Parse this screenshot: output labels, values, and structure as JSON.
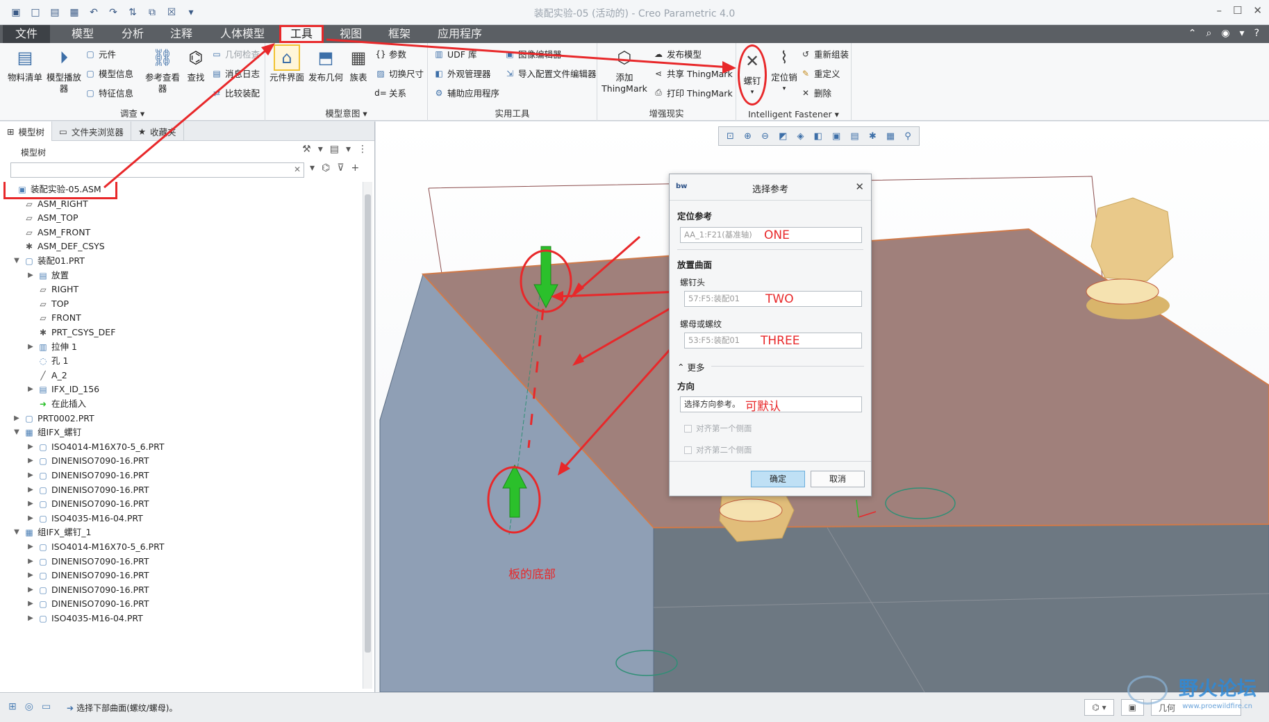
{
  "window": {
    "title": "装配实验-05 (活动的) - Creo Parametric 4.0"
  },
  "tabs": [
    {
      "label": "文件"
    },
    {
      "label": "模型"
    },
    {
      "label": "分析"
    },
    {
      "label": "注释"
    },
    {
      "label": "人体模型"
    },
    {
      "label": "工具"
    },
    {
      "label": "视图"
    },
    {
      "label": "框架"
    },
    {
      "label": "应用程序"
    }
  ],
  "ribbon": {
    "investigate": {
      "label": "调查",
      "bom": "物料清单",
      "model_player": "模型播放器",
      "component": "元件",
      "model_info": "模型信息",
      "feature_info": "特征信息",
      "ref_viewer": "参考查看器",
      "find": "查找",
      "geom_check": "几何检查",
      "message_log": "消息日志",
      "compare_parts": "比较装配"
    },
    "model_intent": {
      "label": "模型意图",
      "component_interface": "元件界面",
      "publish_geometry": "发布几何",
      "family_table": "族表",
      "parameters": "参数",
      "switch_dims": "切换尺寸",
      "relations": "关系"
    },
    "utilities": {
      "label": "实用工具",
      "udf_library": "UDF 库",
      "appearance_manager": "外观管理器",
      "aux_apps": "辅助应用程序",
      "image_editor": "图像编辑器",
      "import_config_editor": "导入配置文件编辑器"
    },
    "augmented_reality": {
      "label": "增强现实",
      "add_thingmark": "添加 ThingMark",
      "publish_model": "发布模型",
      "share_thingmark": "共享 ThingMark",
      "print_thingmark": "打印 ThingMark"
    },
    "fastener": {
      "label": "Intelligent Fastener",
      "screw": "螺钉",
      "dowel_pin": "定位销",
      "reassemble": "重新组装",
      "redefine": "重定义",
      "delete": "删除"
    }
  },
  "left_panel": {
    "tabs": [
      "模型树",
      "文件夹浏览器",
      "收藏夹"
    ],
    "header": "模型树",
    "search_value": "",
    "tree": [
      {
        "label": "装配实验-05.ASM",
        "level": 0,
        "expander": "",
        "icon": "asm"
      },
      {
        "label": "ASM_RIGHT",
        "level": 1,
        "expander": "",
        "icon": "plane"
      },
      {
        "label": "ASM_TOP",
        "level": 1,
        "expander": "",
        "icon": "plane"
      },
      {
        "label": "ASM_FRONT",
        "level": 1,
        "expander": "",
        "icon": "plane"
      },
      {
        "label": "ASM_DEF_CSYS",
        "level": 1,
        "expander": "",
        "icon": "csys"
      },
      {
        "label": "装配01.PRT",
        "level": 1,
        "expander": "▼",
        "icon": "part"
      },
      {
        "label": "放置",
        "level": 2,
        "expander": "▶",
        "icon": "folder"
      },
      {
        "label": "RIGHT",
        "level": 2,
        "expander": "",
        "icon": "plane"
      },
      {
        "label": "TOP",
        "level": 2,
        "expander": "",
        "icon": "plane"
      },
      {
        "label": "FRONT",
        "level": 2,
        "expander": "",
        "icon": "plane"
      },
      {
        "label": "PRT_CSYS_DEF",
        "level": 2,
        "expander": "",
        "icon": "csys"
      },
      {
        "label": "拉伸 1",
        "level": 2,
        "expander": "▶",
        "icon": "extrude"
      },
      {
        "label": "孔 1",
        "level": 2,
        "expander": "",
        "icon": "hole"
      },
      {
        "label": "A_2",
        "level": 2,
        "expander": "",
        "icon": "axis"
      },
      {
        "label": "IFX_ID_156",
        "level": 2,
        "expander": "▶",
        "icon": "folder"
      },
      {
        "label": "在此插入",
        "level": 2,
        "expander": "",
        "icon": "insert"
      },
      {
        "label": "PRT0002.PRT",
        "level": 1,
        "expander": "▶",
        "icon": "part"
      },
      {
        "label": "组IFX_螺钉",
        "level": 1,
        "expander": "▼",
        "icon": "group"
      },
      {
        "label": "ISO4014-M16X70-5_6.PRT",
        "level": 2,
        "expander": "▶",
        "icon": "part"
      },
      {
        "label": "DINENISO7090-16.PRT",
        "level": 2,
        "expander": "▶",
        "icon": "part"
      },
      {
        "label": "DINENISO7090-16.PRT",
        "level": 2,
        "expander": "▶",
        "icon": "part"
      },
      {
        "label": "DINENISO7090-16.PRT",
        "level": 2,
        "expander": "▶",
        "icon": "part"
      },
      {
        "label": "DINENISO7090-16.PRT",
        "level": 2,
        "expander": "▶",
        "icon": "part"
      },
      {
        "label": "ISO4035-M16-04.PRT",
        "level": 2,
        "expander": "▶",
        "icon": "part"
      },
      {
        "label": "组IFX_螺钉_1",
        "level": 1,
        "expander": "▼",
        "icon": "group"
      },
      {
        "label": "ISO4014-M16X70-5_6.PRT",
        "level": 2,
        "expander": "▶",
        "icon": "part"
      },
      {
        "label": "DINENISO7090-16.PRT",
        "level": 2,
        "expander": "▶",
        "icon": "part"
      },
      {
        "label": "DINENISO7090-16.PRT",
        "level": 2,
        "expander": "▶",
        "icon": "part"
      },
      {
        "label": "DINENISO7090-16.PRT",
        "level": 2,
        "expander": "▶",
        "icon": "part"
      },
      {
        "label": "DINENISO7090-16.PRT",
        "level": 2,
        "expander": "▶",
        "icon": "part"
      },
      {
        "label": "ISO4035-M16-04.PRT",
        "level": 2,
        "expander": "▶",
        "icon": "part"
      }
    ]
  },
  "dialog": {
    "logo": "bw",
    "title": "选择参考",
    "locate_ref_label": "定位参考",
    "locate_ref_value": "AA_1:F21(基准轴)",
    "placement_surface_label": "放置曲面",
    "screw_head_label": "螺钉头",
    "screw_head_value": "57:F5:装配01",
    "nut_thread_label": "螺母或螺纹",
    "nut_thread_value": "53:F5:装配01",
    "more_label": "更多",
    "direction_label": "方向",
    "direction_value": "选择方向参考。",
    "align_first_side": "对齐第一个侧面",
    "align_second_side": "对齐第二个侧面",
    "ok": "确定",
    "cancel": "取消"
  },
  "annotations": {
    "one": "ONE",
    "two": "TWO",
    "three": "THREE",
    "default": "可默认",
    "plate_bottom": "板的底部",
    "color": "#e8282a"
  },
  "status": {
    "message": "选择下部曲面(螺纹/螺母)。",
    "filter": "几何"
  },
  "watermark": {
    "text": "野火论坛",
    "sub": "www.proewildfire.cn"
  }
}
